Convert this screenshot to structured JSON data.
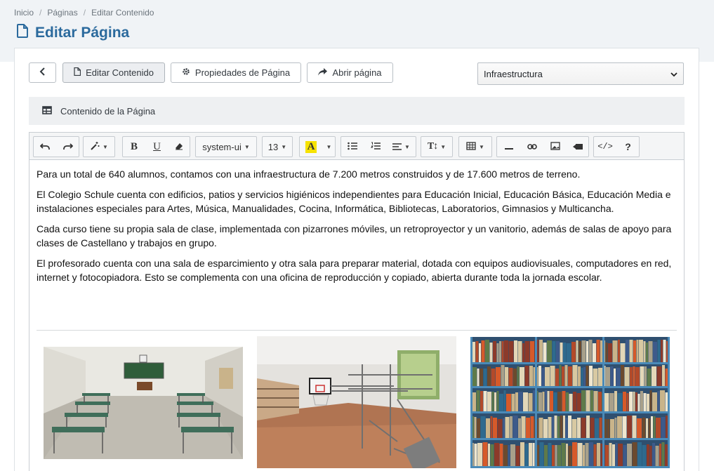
{
  "breadcrumb": [
    "Inicio",
    "Páginas",
    "Editar Contenido"
  ],
  "breadcrumb_separator": "/",
  "page_title": "Editar Página",
  "actions": {
    "edit_content": "Editar Contenido",
    "page_properties": "Propiedades de Página",
    "open_page": "Abrir página"
  },
  "page_select": {
    "selected": "Infraestructura"
  },
  "section_title": "Contenido de la Página",
  "toolbar": {
    "font_family": "system-ui",
    "font_size": "13",
    "icons": [
      "undo-icon",
      "redo-icon",
      "magic-wand-icon",
      "bold-icon",
      "underline-icon",
      "eraser-icon",
      "font-color-icon",
      "unordered-list-icon",
      "ordered-list-icon",
      "align-icon",
      "text-height-icon",
      "table-icon",
      "horizontal-rule-icon",
      "link-icon",
      "picture-icon",
      "video-icon",
      "code-view-icon",
      "help-icon"
    ],
    "highlight_color": "#f6e200"
  },
  "content": {
    "paragraphs": [
      "Para un total de 640 alumnos, contamos con una infraestructura de 7.200 metros construidos y de 17.600 metros de terreno.",
      "El Colegio Schule cuenta con edificios, patios y servicios higiénicos independientes para Educación Inicial, Educación Básica, Educación Media e instalaciones especiales para Artes, Música, Manualidades, Cocina, Informática, Bibliotecas, Laboratorios, Gimnasios y Multicancha.",
      "Cada curso tiene su propia sala de clase, implementada con pizarrones móviles, un retroproyector y un vanitorio, además de salas de apoyo para clases de Castellano y trabajos en grupo.",
      "El profesorado cuenta con una sala de esparcimiento y otra sala para preparar material, dotada con equipos audiovisuales, computadores en red, internet y fotocopiadora. Esto se complementa con una oficina de reproducción y copiado, abierta durante toda la jornada escolar."
    ],
    "images": [
      "classroom-photo",
      "gymnasium-photo",
      "library-photo"
    ]
  },
  "colors": {
    "title": "#2b6a9d",
    "band": "#f0f3f6"
  }
}
